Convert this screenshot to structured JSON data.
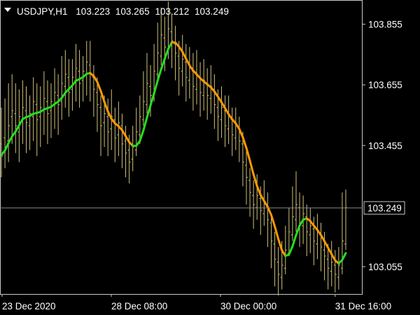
{
  "header": {
    "symbol_timeframe": "USDJPY,H1",
    "open": "103.223",
    "high": "103.265",
    "low": "103.212",
    "close": "103.249"
  },
  "colors": {
    "background": "#000000",
    "frame": "#c8c8c8",
    "bars": "#cfc27a",
    "ma_up": "#22e01e",
    "ma_down": "#ff9900",
    "price_line": "#8a8a8a",
    "text": "#ffffff"
  },
  "chart_data": {
    "type": "line",
    "symbol": "USDJPY",
    "timeframe": "H1",
    "y_tick_labels": [
      "103.855",
      "103.655",
      "103.455",
      "103.055"
    ],
    "y_ticks": [
      103.855,
      103.655,
      103.455,
      103.055
    ],
    "ylim": [
      102.965,
      103.935
    ],
    "x_tick_labels": [
      "23 Dec 2020",
      "28 Dec 08:00",
      "30 Dec 00:00",
      "31 Dec 16:00"
    ],
    "current_price_label": "103.249",
    "current_price": 103.249,
    "grid": false,
    "series": [
      {
        "kind": "bars",
        "values": [
          [
            103.46,
            103.42,
            103.58,
            103.35
          ],
          [
            103.48,
            103.45,
            103.61,
            103.38
          ],
          [
            103.47,
            103.52,
            103.66,
            103.4
          ],
          [
            103.55,
            103.57,
            103.69,
            103.46
          ],
          [
            103.56,
            103.52,
            103.66,
            103.43
          ],
          [
            103.5,
            103.55,
            103.64,
            103.4
          ],
          [
            103.54,
            103.58,
            103.67,
            103.46
          ],
          [
            103.57,
            103.53,
            103.65,
            103.43
          ],
          [
            103.52,
            103.56,
            103.62,
            103.44
          ],
          [
            103.55,
            103.6,
            103.68,
            103.47
          ],
          [
            103.59,
            103.54,
            103.66,
            103.42
          ],
          [
            103.55,
            103.58,
            103.65,
            103.45
          ],
          [
            103.57,
            103.61,
            103.7,
            103.49
          ],
          [
            103.6,
            103.56,
            103.67,
            103.46
          ],
          [
            103.57,
            103.6,
            103.66,
            103.48
          ],
          [
            103.59,
            103.63,
            103.71,
            103.51
          ],
          [
            103.62,
            103.59,
            103.69,
            103.49
          ],
          [
            103.6,
            103.66,
            103.75,
            103.54
          ],
          [
            103.65,
            103.69,
            103.77,
            103.58
          ],
          [
            103.68,
            103.63,
            103.74,
            103.55
          ],
          [
            103.64,
            103.68,
            103.74,
            103.57
          ],
          [
            103.67,
            103.71,
            103.79,
            103.6
          ],
          [
            103.7,
            103.66,
            103.77,
            103.58
          ],
          [
            103.67,
            103.7,
            103.75,
            103.6
          ],
          [
            103.69,
            103.73,
            103.8,
            103.62
          ],
          [
            103.72,
            103.69,
            103.8,
            103.6
          ],
          [
            103.68,
            103.64,
            103.72,
            103.55
          ],
          [
            103.63,
            103.59,
            103.68,
            103.5
          ],
          [
            103.58,
            103.52,
            103.62,
            103.42
          ],
          [
            103.53,
            103.56,
            103.62,
            103.45
          ],
          [
            103.55,
            103.5,
            103.61,
            103.42
          ],
          [
            103.51,
            103.55,
            103.64,
            103.44
          ],
          [
            103.54,
            103.48,
            103.58,
            103.4
          ],
          [
            103.49,
            103.53,
            103.6,
            103.42
          ],
          [
            103.52,
            103.46,
            103.56,
            103.38
          ],
          [
            103.47,
            103.43,
            103.52,
            103.35
          ],
          [
            103.44,
            103.4,
            103.49,
            103.33
          ],
          [
            103.41,
            103.45,
            103.52,
            103.37
          ],
          [
            103.44,
            103.5,
            103.58,
            103.42
          ],
          [
            103.49,
            103.55,
            103.62,
            103.46
          ],
          [
            103.54,
            103.6,
            103.7,
            103.52
          ],
          [
            103.59,
            103.66,
            103.76,
            103.56
          ],
          [
            103.65,
            103.62,
            103.72,
            103.55
          ],
          [
            103.61,
            103.7,
            103.79,
            103.6
          ],
          [
            103.69,
            103.76,
            103.86,
            103.66
          ],
          [
            103.75,
            103.82,
            103.91,
            103.72
          ],
          [
            103.81,
            103.78,
            103.88,
            103.7
          ],
          [
            103.77,
            103.84,
            103.93,
            103.74
          ],
          [
            103.83,
            103.8,
            103.89,
            103.71
          ],
          [
            103.79,
            103.76,
            103.85,
            103.67
          ],
          [
            103.75,
            103.71,
            103.8,
            103.62
          ],
          [
            103.7,
            103.74,
            103.82,
            103.65
          ],
          [
            103.73,
            103.68,
            103.79,
            103.6
          ],
          [
            103.67,
            103.71,
            103.78,
            103.61
          ],
          [
            103.7,
            103.65,
            103.76,
            103.57
          ],
          [
            103.64,
            103.69,
            103.77,
            103.59
          ],
          [
            103.68,
            103.63,
            103.73,
            103.55
          ],
          [
            103.62,
            103.67,
            103.74,
            103.57
          ],
          [
            103.66,
            103.62,
            103.71,
            103.54
          ],
          [
            103.61,
            103.65,
            103.72,
            103.56
          ],
          [
            103.64,
            103.59,
            103.69,
            103.51
          ],
          [
            103.58,
            103.55,
            103.64,
            103.47
          ],
          [
            103.54,
            103.58,
            103.65,
            103.48
          ],
          [
            103.57,
            103.52,
            103.62,
            103.45
          ],
          [
            103.51,
            103.55,
            103.62,
            103.46
          ],
          [
            103.54,
            103.49,
            103.58,
            103.42
          ],
          [
            103.48,
            103.52,
            103.58,
            103.44
          ],
          [
            103.51,
            103.47,
            103.55,
            103.4
          ],
          [
            103.46,
            103.4,
            103.5,
            103.32
          ],
          [
            103.39,
            103.35,
            103.44,
            103.26
          ],
          [
            103.34,
            103.3,
            103.38,
            103.22
          ],
          [
            103.29,
            103.26,
            103.34,
            103.18
          ],
          [
            103.25,
            103.29,
            103.36,
            103.21
          ],
          [
            103.28,
            103.24,
            103.32,
            103.16
          ],
          [
            103.23,
            103.27,
            103.34,
            103.19
          ],
          [
            103.26,
            103.21,
            103.3,
            103.12
          ],
          [
            103.2,
            103.14,
            103.23,
            103.05
          ],
          [
            103.13,
            103.08,
            103.17,
            102.99
          ],
          [
            103.07,
            103.03,
            103.12,
            102.96
          ],
          [
            103.02,
            103.06,
            103.14,
            102.98
          ],
          [
            103.05,
            103.11,
            103.19,
            103.03
          ],
          [
            103.1,
            103.17,
            103.25,
            103.09
          ],
          [
            103.16,
            103.22,
            103.32,
            103.14
          ],
          [
            103.21,
            103.26,
            103.37,
            103.17
          ],
          [
            103.25,
            103.2,
            103.3,
            103.12
          ],
          [
            103.19,
            103.23,
            103.29,
            103.13
          ],
          [
            103.22,
            103.17,
            103.26,
            103.09
          ],
          [
            103.16,
            103.19,
            103.25,
            103.1
          ],
          [
            103.18,
            103.14,
            103.22,
            103.06
          ],
          [
            103.13,
            103.17,
            103.23,
            103.08
          ],
          [
            103.16,
            103.12,
            103.2,
            103.04
          ],
          [
            103.11,
            103.09,
            103.17,
            103.01
          ],
          [
            103.08,
            103.05,
            103.13,
            102.98
          ],
          [
            103.04,
            103.07,
            103.14,
            102.99
          ],
          [
            103.06,
            103.03,
            103.11,
            102.97
          ],
          [
            103.02,
            103.06,
            103.12,
            102.98
          ],
          [
            103.05,
            103.14,
            103.3,
            103.03
          ],
          [
            103.13,
            103.25,
            103.31,
            103.11
          ]
        ]
      },
      {
        "kind": "moving_average",
        "up_color": "ma_up",
        "down_color": "ma_down"
      }
    ]
  }
}
